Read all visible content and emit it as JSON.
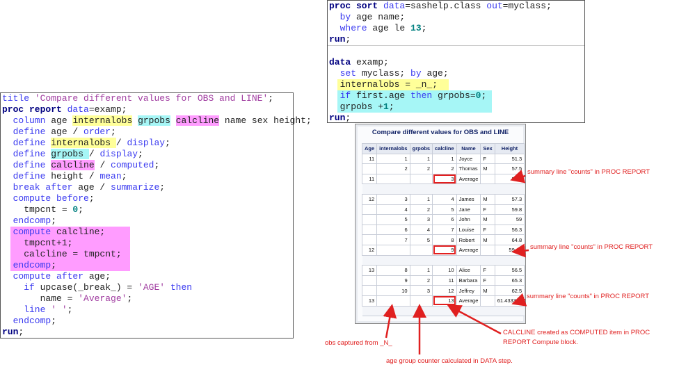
{
  "left_code": {
    "lines": [
      [
        {
          "t": "title ",
          "c": "k"
        },
        {
          "t": "'Compare different values for OBS and LINE'",
          "c": "s"
        },
        {
          "t": ";",
          "c": "x"
        }
      ],
      [
        {
          "t": "proc report ",
          "c": "p"
        },
        {
          "t": "data",
          "c": "k"
        },
        {
          "t": "=examp;",
          "c": "x"
        }
      ],
      [
        {
          "t": "  column ",
          "c": "k"
        },
        {
          "t": "age ",
          "c": "x"
        },
        {
          "t": "internalobs",
          "c": "x",
          "hl": "hy"
        },
        {
          "t": " ",
          "c": "x"
        },
        {
          "t": "grpobs",
          "c": "x",
          "hl": "hc"
        },
        {
          "t": " ",
          "c": "x"
        },
        {
          "t": "calcline",
          "c": "x",
          "hl": "hm"
        },
        {
          "t": " name sex height;",
          "c": "x"
        }
      ],
      [
        {
          "t": "  define ",
          "c": "k"
        },
        {
          "t": "age / ",
          "c": "x"
        },
        {
          "t": "order",
          "c": "k"
        },
        {
          "t": ";",
          "c": "x"
        }
      ],
      [
        {
          "t": "  define ",
          "c": "k"
        },
        {
          "t": "internalobs ",
          "c": "x",
          "hl": "hy"
        },
        {
          "t": "/ ",
          "c": "x"
        },
        {
          "t": "display",
          "c": "k"
        },
        {
          "t": ";",
          "c": "x"
        }
      ],
      [
        {
          "t": "  define ",
          "c": "k"
        },
        {
          "t": "grpobs ",
          "c": "x",
          "hl": "hc"
        },
        {
          "t": "/ ",
          "c": "x"
        },
        {
          "t": "display",
          "c": "k"
        },
        {
          "t": ";",
          "c": "x"
        }
      ],
      [
        {
          "t": "  define ",
          "c": "k"
        },
        {
          "t": "calcline",
          "c": "x",
          "hl": "hm"
        },
        {
          "t": " / ",
          "c": "x"
        },
        {
          "t": "computed",
          "c": "k"
        },
        {
          "t": ";",
          "c": "x"
        }
      ],
      [
        {
          "t": "  define ",
          "c": "k"
        },
        {
          "t": "height / ",
          "c": "x"
        },
        {
          "t": "mean",
          "c": "k"
        },
        {
          "t": ";",
          "c": "x"
        }
      ],
      [
        {
          "t": "  break after ",
          "c": "k"
        },
        {
          "t": "age / ",
          "c": "x"
        },
        {
          "t": "summarize",
          "c": "k"
        },
        {
          "t": ";",
          "c": "x"
        }
      ],
      [
        {
          "t": "  compute before",
          "c": "k"
        },
        {
          "t": ";",
          "c": "x"
        }
      ],
      [
        {
          "t": "    tmpcnt = ",
          "c": "x"
        },
        {
          "t": "0",
          "c": "n"
        },
        {
          "t": ";",
          "c": "x"
        }
      ],
      [
        {
          "t": "  endcomp",
          "c": "k"
        },
        {
          "t": ";",
          "c": "x"
        }
      ],
      [
        {
          "t": "  compute ",
          "c": "k",
          "line_hl": "hm"
        },
        {
          "t": "calcline;",
          "c": "x"
        }
      ],
      [
        {
          "t": "    tmpcnt+1;",
          "c": "x",
          "line_hl": "hm"
        }
      ],
      [
        {
          "t": "    calcline = tmpcnt;",
          "c": "x",
          "line_hl": "hm"
        }
      ],
      [
        {
          "t": "  endcomp",
          "c": "k",
          "line_hl": "hm"
        },
        {
          "t": ";",
          "c": "x"
        }
      ],
      [
        {
          "t": "  compute after ",
          "c": "k"
        },
        {
          "t": "age;",
          "c": "x"
        }
      ],
      [
        {
          "t": "    if ",
          "c": "k"
        },
        {
          "t": "upcase(_break_) = ",
          "c": "x"
        },
        {
          "t": "'AGE'",
          "c": "s"
        },
        {
          "t": " then",
          "c": "k"
        }
      ],
      [
        {
          "t": "       name = ",
          "c": "x"
        },
        {
          "t": "'Average'",
          "c": "s"
        },
        {
          "t": ";",
          "c": "x"
        }
      ],
      [
        {
          "t": "    line ",
          "c": "k"
        },
        {
          "t": "' '",
          "c": "s"
        },
        {
          "t": ";",
          "c": "x"
        }
      ],
      [
        {
          "t": "  endcomp",
          "c": "k"
        },
        {
          "t": ";",
          "c": "x"
        }
      ],
      [
        {
          "t": "run",
          "c": "p"
        },
        {
          "t": ";",
          "c": "x"
        }
      ]
    ]
  },
  "top_code": {
    "lines": [
      [
        {
          "t": "proc sort ",
          "c": "p"
        },
        {
          "t": "data",
          "c": "k"
        },
        {
          "t": "=sashelp.class ",
          "c": "x"
        },
        {
          "t": "out",
          "c": "k"
        },
        {
          "t": "=myclass;",
          "c": "x"
        }
      ],
      [
        {
          "t": "  by ",
          "c": "k"
        },
        {
          "t": "age name;",
          "c": "x"
        }
      ],
      [
        {
          "t": "  where ",
          "c": "k"
        },
        {
          "t": "age le ",
          "c": "x"
        },
        {
          "t": "13",
          "c": "n"
        },
        {
          "t": ";",
          "c": "x"
        }
      ],
      [
        {
          "t": "run",
          "c": "p"
        },
        {
          "t": ";",
          "c": "x"
        }
      ],
      [
        {
          "t": "",
          "c": "x",
          "sep": true
        }
      ],
      [
        {
          "t": "data ",
          "c": "p"
        },
        {
          "t": "examp;",
          "c": "x"
        }
      ],
      [
        {
          "t": "  set ",
          "c": "k"
        },
        {
          "t": "myclass; ",
          "c": "x"
        },
        {
          "t": "by ",
          "c": "k"
        },
        {
          "t": "age;",
          "c": "x"
        }
      ],
      [
        {
          "t": "  internalobs = _n_;",
          "c": "x",
          "line_hl": "hy"
        }
      ],
      [
        {
          "t": "  if ",
          "c": "k",
          "line_hl": "hc"
        },
        {
          "t": "first.age ",
          "c": "x"
        },
        {
          "t": "then ",
          "c": "k"
        },
        {
          "t": "grpobs=",
          "c": "x"
        },
        {
          "t": "0",
          "c": "n"
        },
        {
          "t": ";",
          "c": "x"
        }
      ],
      [
        {
          "t": "  grpobs +",
          "c": "x",
          "line_hl": "hc"
        },
        {
          "t": "1",
          "c": "n"
        },
        {
          "t": ";",
          "c": "x"
        }
      ],
      [
        {
          "t": "run",
          "c": "p"
        },
        {
          "t": ";",
          "c": "x"
        }
      ]
    ]
  },
  "report": {
    "title": "Compare different values for OBS and LINE",
    "columns": [
      "Age",
      "internalobs",
      "grpobs",
      "calcline",
      "Name",
      "Sex",
      "Height"
    ],
    "rows": [
      [
        "11",
        "1",
        "1",
        "1",
        "Joyce",
        "F",
        "51.3"
      ],
      [
        "",
        "2",
        "2",
        "2",
        "Thomas",
        "M",
        "57.5"
      ],
      [
        "11",
        "",
        "",
        "3",
        "Average",
        "",
        "54.4"
      ],
      null,
      [
        "12",
        "3",
        "1",
        "4",
        "James",
        "M",
        "57.3"
      ],
      [
        "",
        "4",
        "2",
        "5",
        "Jane",
        "F",
        "59.8"
      ],
      [
        "",
        "5",
        "3",
        "6",
        "John",
        "M",
        "59"
      ],
      [
        "",
        "6",
        "4",
        "7",
        "Louise",
        "F",
        "56.3"
      ],
      [
        "",
        "7",
        "5",
        "8",
        "Robert",
        "M",
        "64.8"
      ],
      [
        "12",
        "",
        "",
        "9",
        "Average",
        "",
        "59.44"
      ],
      null,
      [
        "13",
        "8",
        "1",
        "10",
        "Alice",
        "F",
        "56.5"
      ],
      [
        "",
        "9",
        "2",
        "11",
        "Barbara",
        "F",
        "65.3"
      ],
      [
        "",
        "10",
        "3",
        "12",
        "Jeffrey",
        "M",
        "62.5"
      ],
      [
        "13",
        "",
        "",
        "13",
        "Average",
        "",
        "61.433333"
      ],
      null
    ]
  },
  "annotations": {
    "summary1": "summary line \"counts\" in PROC REPORT",
    "summary2": "summary line \"counts\" in PROC REPORT",
    "summary3": "summary line \"counts\" in PROC REPORT",
    "calcline": "CALCLINE created as COMPUTED item in PROC REPORT Compute block.",
    "obs": "obs captured from _N_",
    "grp": "age group counter calculated in DATA step."
  },
  "colors": {
    "annotation": "#e02020",
    "highlight_yellow": "#ffff99",
    "highlight_cyan": "#a6f6f6",
    "highlight_pink": "#ff9cff"
  }
}
